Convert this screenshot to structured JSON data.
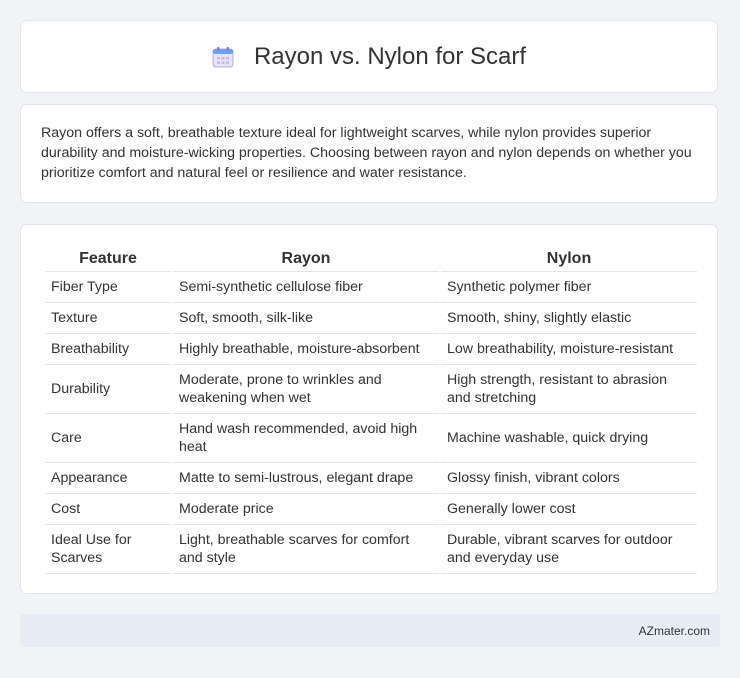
{
  "header": {
    "icon": "calendar-icon",
    "title": "Rayon vs. Nylon for Scarf"
  },
  "summary": {
    "text": "Rayon offers a soft, breathable texture ideal for lightweight scarves, while nylon provides superior durability and moisture-wicking properties. Choosing between rayon and nylon depends on whether you prioritize comfort and natural feel or resilience and water resistance."
  },
  "table": {
    "headers": [
      "Feature",
      "Rayon",
      "Nylon"
    ],
    "rows": [
      {
        "feature": "Fiber Type",
        "rayon": "Semi-synthetic cellulose fiber",
        "nylon": "Synthetic polymer fiber"
      },
      {
        "feature": "Texture",
        "rayon": "Soft, smooth, silk-like",
        "nylon": "Smooth, shiny, slightly elastic"
      },
      {
        "feature": "Breathability",
        "rayon": "Highly breathable, moisture-absorbent",
        "nylon": "Low breathability, moisture-resistant"
      },
      {
        "feature": "Durability",
        "rayon": "Moderate, prone to wrinkles and weakening when wet",
        "nylon": "High strength, resistant to abrasion and stretching"
      },
      {
        "feature": "Care",
        "rayon": "Hand wash recommended, avoid high heat",
        "nylon": "Machine washable, quick drying"
      },
      {
        "feature": "Appearance",
        "rayon": "Matte to semi-lustrous, elegant drape",
        "nylon": "Glossy finish, vibrant colors"
      },
      {
        "feature": "Cost",
        "rayon": "Moderate price",
        "nylon": "Generally lower cost"
      },
      {
        "feature": "Ideal Use for Scarves",
        "rayon": "Light, breathable scarves for comfort and style",
        "nylon": "Durable, vibrant scarves for outdoor and everyday use"
      }
    ]
  },
  "footer": {
    "site": "AZmater.com"
  }
}
